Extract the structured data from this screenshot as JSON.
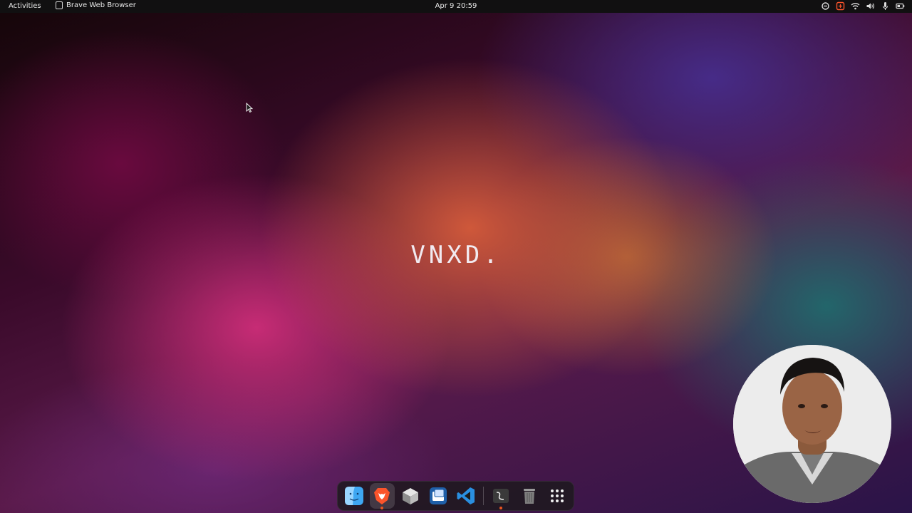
{
  "topbar": {
    "activities_label": "Activities",
    "focused_app": "Brave Web Browser",
    "clock": "Apr 9  20:59",
    "tray_icons": [
      "vpn-icon",
      "brave-notify-icon",
      "wifi-icon",
      "volume-icon",
      "microphone-icon",
      "battery-icon"
    ]
  },
  "desktop": {
    "brand_text": "VNXD."
  },
  "dock": {
    "items": [
      {
        "icon": "finder-icon",
        "running": false
      },
      {
        "icon": "brave-icon",
        "running": true,
        "active": true
      },
      {
        "icon": "box-3d-icon",
        "running": false
      },
      {
        "icon": "virtualbox-icon",
        "running": false
      },
      {
        "icon": "vscode-icon",
        "running": false
      },
      {
        "icon": "terminal-app-icon",
        "running": true
      },
      {
        "icon": "trash-icon",
        "running": false
      },
      {
        "icon": "app-grid-icon",
        "running": false
      }
    ]
  },
  "colors": {
    "accent": "#e95420",
    "topbar_bg": "#111011",
    "brave_orange": "#fb542b",
    "vscode_blue": "#2a8fe0"
  }
}
